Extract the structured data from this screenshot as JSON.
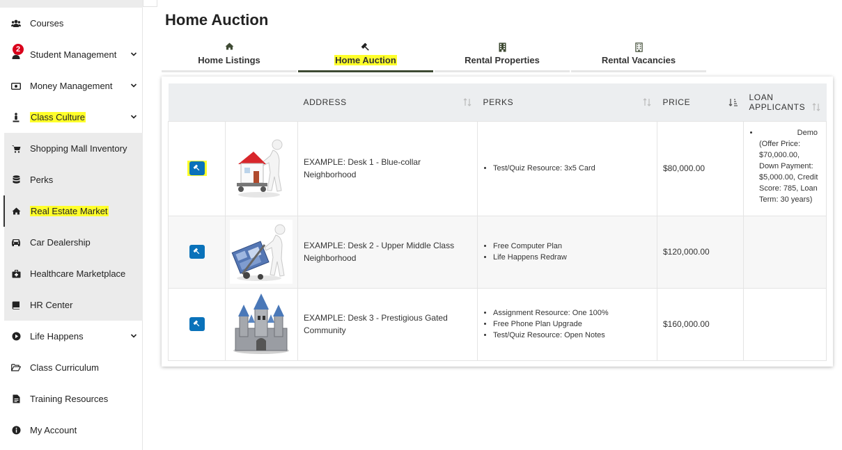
{
  "sidebar": {
    "items": [
      {
        "label": "Courses",
        "icon": "users-icon"
      },
      {
        "label": "Student Management",
        "icon": "user-icon",
        "badge": "2"
      },
      {
        "label": "Money Management",
        "icon": "money-icon"
      },
      {
        "label": "Class Culture",
        "icon": "person-icon"
      },
      {
        "label": "Shopping Mall Inventory",
        "icon": "cart-icon"
      },
      {
        "label": "Perks",
        "icon": "database-icon"
      },
      {
        "label": "Real Estate Market",
        "icon": "home-icon"
      },
      {
        "label": "Car Dealership",
        "icon": "car-icon"
      },
      {
        "label": "Healthcare Marketplace",
        "icon": "medkit-icon"
      },
      {
        "label": "HR Center",
        "icon": "book-icon"
      },
      {
        "label": "Life Happens",
        "icon": "play-circle-icon"
      },
      {
        "label": "Class Curriculum",
        "icon": "folder-open-icon"
      },
      {
        "label": "Training Resources",
        "icon": "file-icon"
      },
      {
        "label": "My Account",
        "icon": "info-circle-icon"
      }
    ]
  },
  "page": {
    "title": "Home Auction"
  },
  "tabs": [
    {
      "label": "Home Listings",
      "icon": "home-icon"
    },
    {
      "label": "Home Auction",
      "icon": "gavel-icon",
      "active": true
    },
    {
      "label": "Rental Properties",
      "icon": "building-icon"
    },
    {
      "label": "Rental Vacancies",
      "icon": "building-outline-icon"
    }
  ],
  "table": {
    "headers": {
      "address": "ADDRESS",
      "perks": "PERKS",
      "price": "PRICE",
      "loan_line1": "LOAN",
      "loan_line2": "APPLICANTS"
    },
    "rows": [
      {
        "address": "EXAMPLE: Desk 1 - Blue-collar Neighborhood",
        "perks": [
          "Test/Quiz Resource: 3x5 Card"
        ],
        "price": "$80,000.00",
        "loan_applicants": {
          "name": "Demo",
          "details": "(Offer Price: $70,000.00, Down Payment: $5,000.00, Credit Score: 785, Loan Term: 30 years)"
        }
      },
      {
        "address": "EXAMPLE: Desk 2 - Upper Middle Class Neighborhood",
        "perks": [
          "Free Computer Plan",
          "Life Happens Redraw"
        ],
        "price": "$120,000.00"
      },
      {
        "address": "EXAMPLE: Desk 3 - Prestigious Gated Community",
        "perks": [
          "Assignment Resource: One 100%",
          "Free Phone Plan Upgrade",
          "Test/Quiz Resource: Open Notes"
        ],
        "price": "$160,000.00"
      }
    ]
  },
  "colors": {
    "accent": "#0a72ba",
    "highlight": "#ffff2a",
    "tab_active": "#3e4a33",
    "badge": "#d9001b"
  }
}
